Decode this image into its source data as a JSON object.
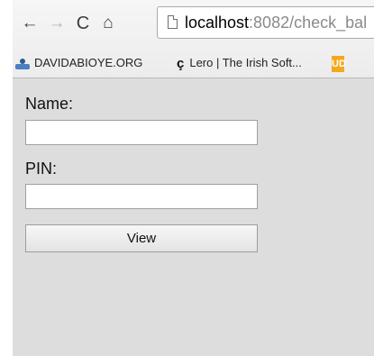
{
  "browser": {
    "nav": {
      "back_glyph": "←",
      "forward_glyph": "→",
      "reload_glyph": "C",
      "home_glyph": "⌂"
    },
    "url": {
      "host": "localhost",
      "rest": ":8082/check_bal"
    },
    "bookmarks": [
      {
        "label": "DAVIDABIOYE.ORG",
        "icon": "person-icon"
      },
      {
        "label": "Lero | The Irish Soft...",
        "icon": "lero-icon"
      },
      {
        "label": "",
        "icon": "ud-icon",
        "badge": "UD"
      }
    ]
  },
  "form": {
    "name_label": "Name:",
    "name_value": "",
    "pin_label": "PIN:",
    "pin_value": "",
    "view_button": "View"
  }
}
